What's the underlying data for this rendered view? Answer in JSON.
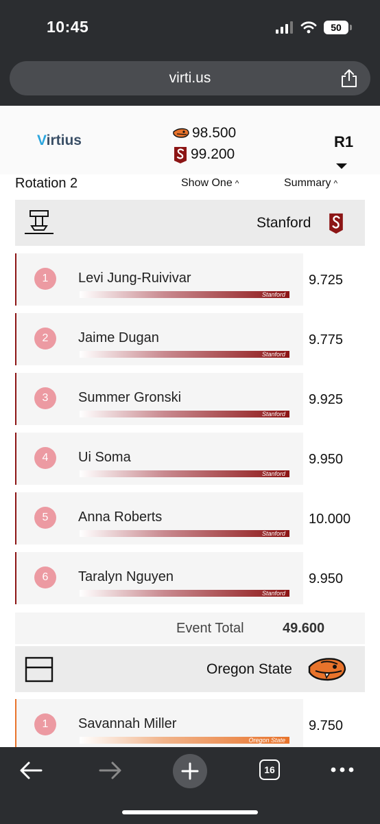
{
  "status_bar": {
    "time": "10:45",
    "battery": "50"
  },
  "browser": {
    "url": "virti.us",
    "tab_count": "16"
  },
  "header": {
    "logo_v": "V",
    "logo_rest": "irtius",
    "scores": [
      {
        "team": "Oregon State",
        "value": "98.500"
      },
      {
        "team": "Stanford",
        "value": "99.200"
      }
    ],
    "round": "R1"
  },
  "controls": {
    "rotation": "Rotation 2",
    "show_one": "Show One",
    "summary": "Summary",
    "caret": "^"
  },
  "stanford": {
    "team_name": "Stanford",
    "athletes": [
      {
        "num": "1",
        "name": "Levi Jung-Ruivivar",
        "team": "Stanford",
        "score": "9.725"
      },
      {
        "num": "2",
        "name": "Jaime Dugan",
        "team": "Stanford",
        "score": "9.775"
      },
      {
        "num": "3",
        "name": "Summer Gronski",
        "team": "Stanford",
        "score": "9.925"
      },
      {
        "num": "4",
        "name": "Ui Soma",
        "team": "Stanford",
        "score": "9.950"
      },
      {
        "num": "5",
        "name": "Anna Roberts",
        "team": "Stanford",
        "score": "10.000"
      },
      {
        "num": "6",
        "name": "Taralyn Nguyen",
        "team": "Stanford",
        "score": "9.950"
      }
    ],
    "event_total_label": "Event Total",
    "event_total_value": "49.600"
  },
  "oregon_state": {
    "team_name": "Oregon State",
    "athletes": [
      {
        "num": "1",
        "name": "Savannah Miller",
        "team": "Oregon State",
        "score": "9.750"
      }
    ]
  },
  "colors": {
    "stanford": "#8c1515",
    "oregon_state": "#e8732b",
    "badge": "#ec9aa2",
    "chrome": "#2b2d30"
  }
}
